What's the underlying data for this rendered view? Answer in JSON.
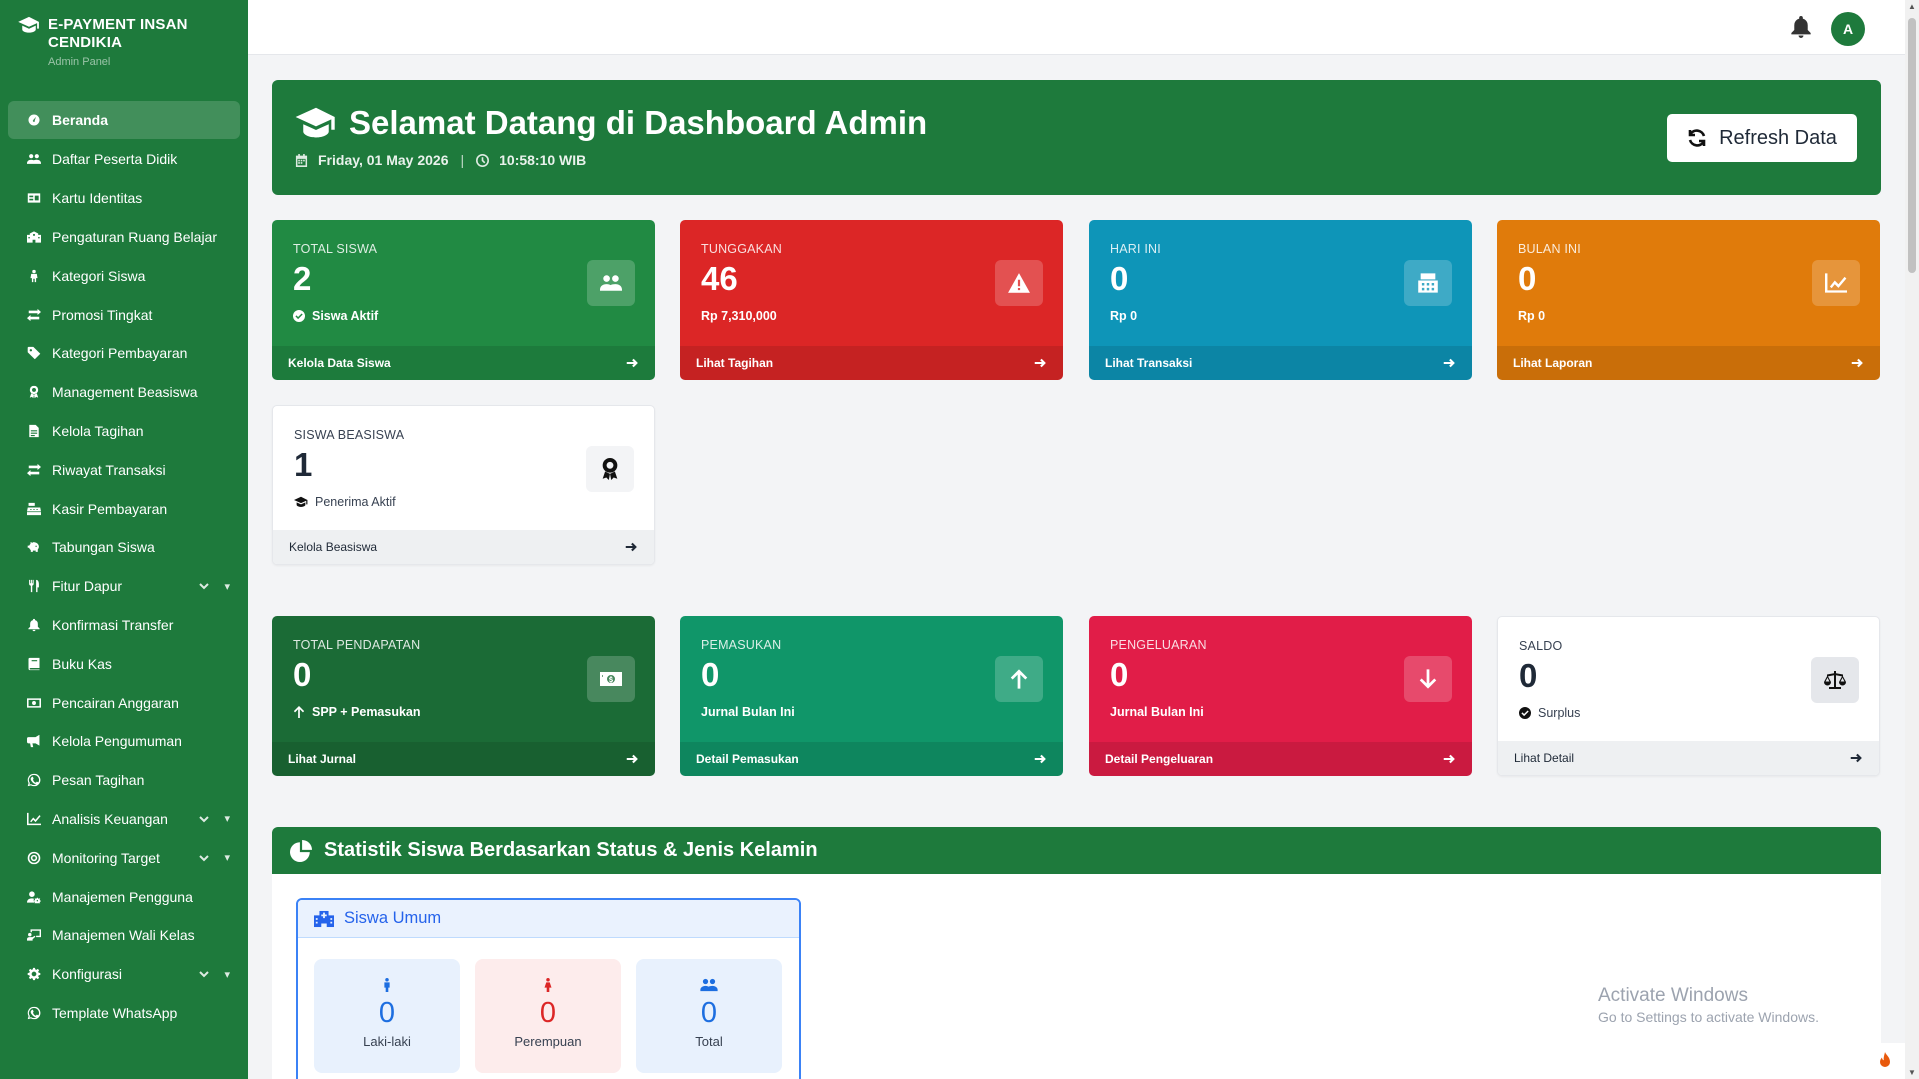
{
  "brand": {
    "title": "E-PAYMENT INSAN CENDIKIA",
    "subtitle": "Admin Panel"
  },
  "sidebar": {
    "items": [
      {
        "label": "Beranda",
        "icon": "dashboard-icon",
        "active": true
      },
      {
        "label": "Daftar Peserta Didik",
        "icon": "users-icon"
      },
      {
        "label": "Kartu Identitas",
        "icon": "id-card-icon"
      },
      {
        "label": "Pengaturan Ruang Belajar",
        "icon": "school-icon"
      },
      {
        "label": "Kategori Siswa",
        "icon": "child-icon"
      },
      {
        "label": "Promosi Tingkat",
        "icon": "exchange-icon"
      },
      {
        "label": "Kategori Pembayaran",
        "icon": "tag-icon"
      },
      {
        "label": "Management Beasiswa",
        "icon": "award-icon"
      },
      {
        "label": "Kelola Tagihan",
        "icon": "invoice-icon"
      },
      {
        "label": "Riwayat Transaksi",
        "icon": "exchange-icon"
      },
      {
        "label": "Kasir Pembayaran",
        "icon": "cash-register-icon"
      },
      {
        "label": "Tabungan Siswa",
        "icon": "piggy-bank-icon"
      },
      {
        "label": "Fitur Dapur",
        "icon": "utensils-icon",
        "expandable": true
      },
      {
        "label": "Konfirmasi Transfer",
        "icon": "bell-icon"
      },
      {
        "label": "Buku Kas",
        "icon": "book-icon"
      },
      {
        "label": "Pencairan Anggaran",
        "icon": "money-icon"
      },
      {
        "label": "Kelola Pengumuman",
        "icon": "megaphone-icon"
      },
      {
        "label": "Pesan Tagihan",
        "icon": "whatsapp-icon"
      },
      {
        "label": "Analisis Keuangan",
        "icon": "chart-line-icon",
        "expandable": true
      },
      {
        "label": "Monitoring Target",
        "icon": "target-icon",
        "expandable": true
      },
      {
        "label": "Manajemen Pengguna",
        "icon": "user-gear-icon"
      },
      {
        "label": "Manajemen Wali Kelas",
        "icon": "teacher-icon"
      },
      {
        "label": "Konfigurasi",
        "icon": "gear-icon",
        "expandable": true
      },
      {
        "label": "Template WhatsApp",
        "icon": "whatsapp-icon"
      }
    ]
  },
  "topbar": {
    "avatar_initial": "A"
  },
  "welcome": {
    "title": "Selamat Datang di Dashboard Admin",
    "date": "Friday, 01 May 2026",
    "separator": "|",
    "time": "10:58:10 WIB",
    "refresh_label": "Refresh Data"
  },
  "cards": {
    "total_siswa": {
      "label": "TOTAL SISWA",
      "value": "2",
      "sub": "Siswa Aktif",
      "link": "Kelola Data Siswa",
      "color": "#218a43"
    },
    "tunggakan": {
      "label": "TUNGGAKAN",
      "value": "46",
      "sub": "Rp 7,310,000",
      "link": "Lihat Tagihan",
      "color": "#dc2626"
    },
    "hari_ini": {
      "label": "HARI INI",
      "value": "0",
      "sub": "Rp 0",
      "link": "Lihat Transaksi",
      "color": "#0e95b8"
    },
    "bulan_ini": {
      "label": "BULAN INI",
      "value": "0",
      "sub": "Rp 0",
      "link": "Lihat Laporan",
      "color": "#e07b0b"
    },
    "siswa_beasiswa": {
      "label": "SISWA BEASISWA",
      "value": "1",
      "sub": "Penerima Aktif",
      "link": "Kelola Beasiswa"
    },
    "total_pendapatan": {
      "label": "TOTAL PENDAPATAN",
      "value": "0",
      "sub": "SPP + Pemasukan",
      "link": "Lihat Jurnal",
      "color": "#1b6b36"
    },
    "pemasukan": {
      "label": "PEMASUKAN",
      "value": "0",
      "sub": "Jurnal Bulan Ini",
      "link": "Detail Pemasukan",
      "color": "#109669"
    },
    "pengeluaran": {
      "label": "PENGELUARAN",
      "value": "0",
      "sub": "Jurnal Bulan Ini",
      "link": "Detail Pengeluaran",
      "color": "#e11d48"
    },
    "saldo": {
      "label": "SALDO",
      "value": "0",
      "sub": "Surplus",
      "link": "Lihat Detail"
    }
  },
  "statistik": {
    "title": "Statistik Siswa Berdasarkan Status & Jenis Kelamin",
    "umum": {
      "title": "Siswa Umum",
      "laki": {
        "value": "0",
        "label": "Laki-laki"
      },
      "perempuan": {
        "value": "0",
        "label": "Perempuan"
      },
      "total": {
        "value": "0",
        "label": "Total"
      }
    }
  },
  "watermark": {
    "line1": "Activate Windows",
    "line2": "Go to Settings to activate Windows."
  }
}
